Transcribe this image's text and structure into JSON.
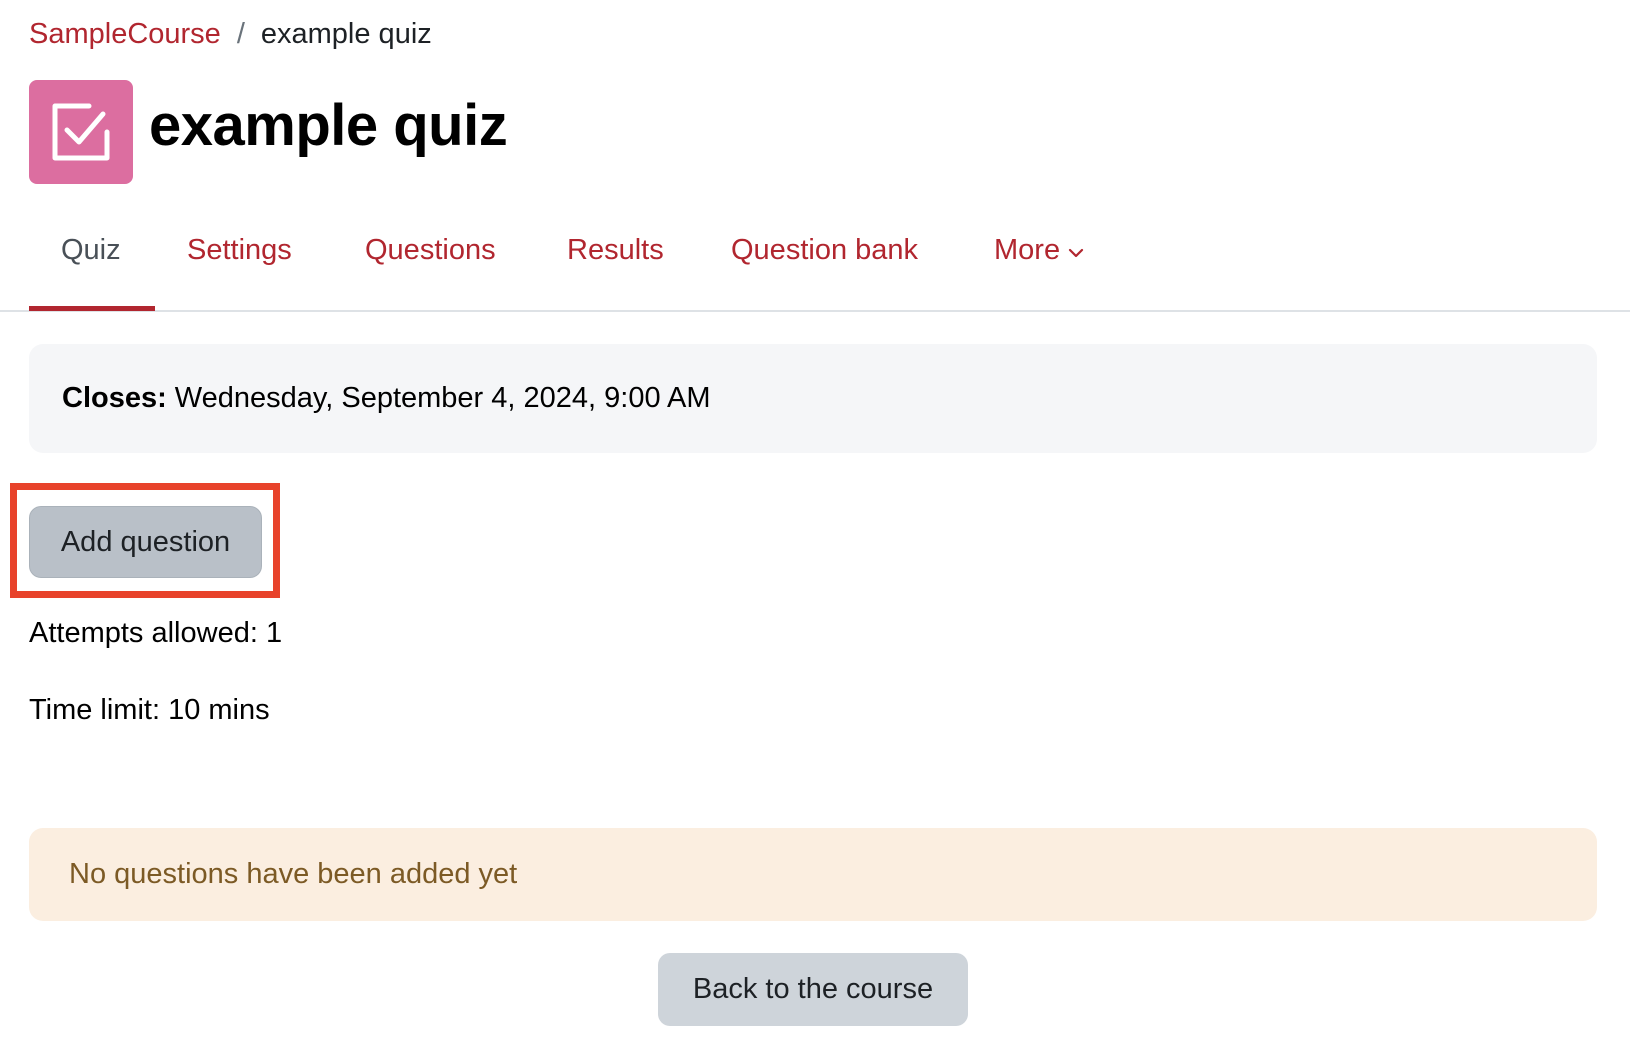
{
  "breadcrumb": {
    "items": [
      {
        "label": "SampleCourse",
        "link": true
      },
      {
        "label": "example quiz",
        "link": false
      }
    ],
    "separator": "/"
  },
  "header": {
    "icon": "quiz-checkbox-icon",
    "icon_color": "#dc6ea0",
    "title": "example quiz"
  },
  "tabs": [
    {
      "label": "Quiz",
      "active": true
    },
    {
      "label": "Settings",
      "active": false
    },
    {
      "label": "Questions",
      "active": false
    },
    {
      "label": "Results",
      "active": false
    },
    {
      "label": "Question bank",
      "active": false
    },
    {
      "label": "More",
      "active": false,
      "icon": "chevron-down-icon"
    }
  ],
  "closes": {
    "label": "Closes:",
    "value": "Wednesday, September 4, 2024, 9:00 AM"
  },
  "actions": {
    "add_question": "Add question",
    "back_to_course": "Back to the course"
  },
  "info": {
    "attempts": "Attempts allowed: 1",
    "time_limit": "Time limit: 10 mins"
  },
  "alert": {
    "message": "No questions have been added yet"
  },
  "colors": {
    "brand": "#b1262f",
    "highlight": "#e8432b",
    "alert_bg": "#fbeee0",
    "alert_text": "#7c5a25"
  }
}
